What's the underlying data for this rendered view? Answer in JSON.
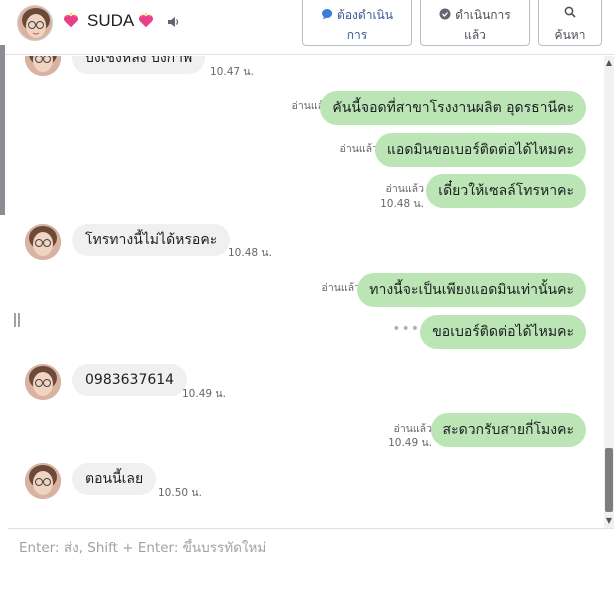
{
  "header": {
    "contact_name": "SUDA",
    "buttons": {
      "todo_line1": "ต้องดำเนิน",
      "todo_line2": "การ",
      "done_line1": "ดำเนินการ",
      "done_line2": "แล้ว",
      "search_label": "ค้นหา"
    }
  },
  "messages": {
    "m0": {
      "text": "บังเชงหลัง บังกาพ",
      "time": "10.47 น."
    },
    "m1": {
      "text": "คันนี้จอดที่สาขาโรงงานผลิต อุดรธานีคะ",
      "status": "อ่านแล้ว"
    },
    "m2": {
      "text": "แอดมินขอเบอร์ติดต่อได้ไหมคะ",
      "status": "อ่านแล้ว"
    },
    "m3": {
      "text": "เดี๋ยวให้เซลล์โทรหาคะ",
      "status": "อ่านแล้ว",
      "time": "10.48 น."
    },
    "m4": {
      "text": "โทรทางนี้ไม่ได้หรอคะ",
      "time": "10.48 น."
    },
    "m5": {
      "text": "ทางนี้จะเป็นเพียงแอดมินเท่านั้นคะ",
      "status": "อ่านแล้ว"
    },
    "m6": {
      "text": "ขอเบอร์ติดต่อได้ไหมคะ",
      "pending": "•••"
    },
    "m7": {
      "text": "0983637614",
      "time": "10.49 น."
    },
    "m8": {
      "text": "สะดวกรับสายกี่โมงคะ",
      "status": "อ่านแล้ว",
      "time": "10.49 น."
    },
    "m9": {
      "text": "ตอนนี้เลย",
      "time": "10.50 น."
    }
  },
  "composer": {
    "placeholder": "Enter: ส่ง, Shift + Enter: ขึ้นบรรทัดใหม่"
  },
  "colors": {
    "outgoing_bubble": "#bce5b5",
    "incoming_bubble": "#f0f0f0",
    "accent": "#365899"
  }
}
